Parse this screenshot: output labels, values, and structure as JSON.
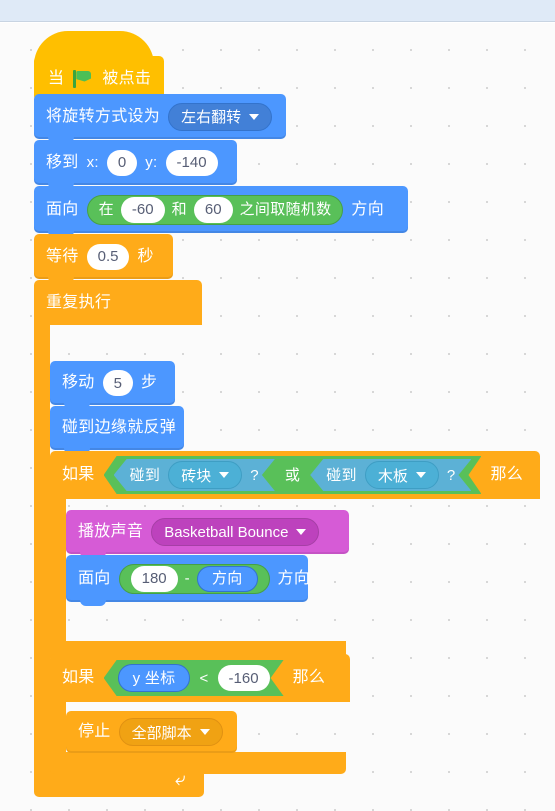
{
  "workspace": {
    "name": "scratch-block-workspace",
    "background_color": "#fbfbfb",
    "grid_dot_color": "#d7d7d7",
    "topbar_color": "#dfeaf7"
  },
  "palette": {
    "event_color": "#ffbf00",
    "motion_color": "#4c97ff",
    "control_color": "#ffab19",
    "sound_color": "#d65bd6",
    "operator_color": "#59c059",
    "sensing_color": "#5cb1d6"
  },
  "script": {
    "hat": {
      "prefix": "当",
      "icon": "green-flag-icon",
      "suffix": "被点击"
    },
    "set_rotation_style": {
      "label": "将旋转方式设为",
      "value": "左右翻转"
    },
    "goto_xy": {
      "label": "移到",
      "x_label": "x:",
      "x_value": "0",
      "y_label": "y:",
      "y_value": "-140"
    },
    "point_in_direction_random": {
      "label": "面向",
      "random_prefix": "在",
      "random_min": "-60",
      "random_mid": "和",
      "random_max": "60",
      "random_suffix": "之间取随机数",
      "suffix": "方向"
    },
    "wait": {
      "label": "等待",
      "value": "0.5",
      "unit": "秒"
    },
    "forever": {
      "label": "重复执行",
      "loop_icon": "loop-arrow-icon"
    },
    "move_steps": {
      "label": "移动",
      "value": "5",
      "unit": "步"
    },
    "bounce_on_edge": {
      "label": "碰到边缘就反弹"
    },
    "if_touching": {
      "if_label": "如果",
      "then_label": "那么",
      "condition": {
        "left": {
          "label": "碰到",
          "target": "砖块",
          "question": "?"
        },
        "operator": "或",
        "right": {
          "label": "碰到",
          "target": "木板",
          "question": "?"
        }
      }
    },
    "play_sound": {
      "label": "播放声音",
      "value": "Basketball Bounce"
    },
    "point_in_direction_calc": {
      "label": "面向",
      "operand_a": "180",
      "operator": "-",
      "operand_b": "方向",
      "suffix": "方向"
    },
    "if_y_below": {
      "if_label": "如果",
      "then_label": "那么",
      "condition": {
        "left": "y 坐标",
        "operator": "<",
        "right": "-160"
      }
    },
    "stop": {
      "label": "停止",
      "value": "全部脚本"
    }
  }
}
